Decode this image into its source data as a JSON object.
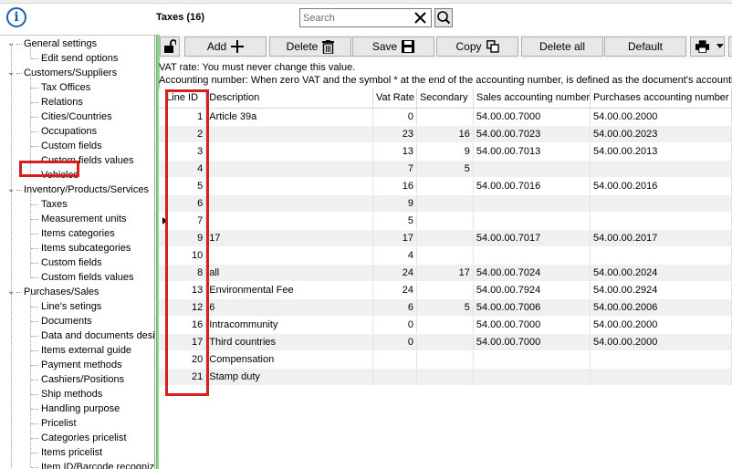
{
  "window": {
    "title": "Taxes (16)"
  },
  "search": {
    "placeholder": "Search",
    "value": ""
  },
  "toolbar": {
    "add_label": "Add",
    "delete_label": "Delete",
    "save_label": "Save",
    "copy_label": "Copy",
    "delete_all_label": "Delete all",
    "default_label": "Default"
  },
  "notes": {
    "vat_rate": "VAT rate: You must never change this value.",
    "accounting": "Accounting number: When zero VAT and the symbol * at the end of the accounting number, is defined as the document's accountin"
  },
  "sidebar": {
    "selected": "Taxes",
    "groups": [
      {
        "label": "General settings",
        "items": [
          "Edit send options"
        ]
      },
      {
        "label": "Customers/Suppliers",
        "items": [
          "Tax Offices",
          "Relations",
          "Cities/Countries",
          "Occupations",
          "Custom fields",
          "Custom fields values",
          "Vehicles"
        ]
      },
      {
        "label": "Inventory/Products/Services",
        "items": [
          "Taxes",
          "Measurement units",
          "Items categories",
          "Items subcategories",
          "Custom fields",
          "Custom fields values"
        ]
      },
      {
        "label": "Purchases/Sales",
        "items": [
          "Line's setings",
          "Documents",
          "Data and documents desi",
          "Items external guide",
          "Payment methods",
          "Cashiers/Positions",
          "Ship methods",
          "Handling purpose",
          "Pricelist",
          "Categories pricelist",
          "Items pricelist",
          "Item ID/Barcode recogniz"
        ]
      }
    ]
  },
  "table": {
    "columns": [
      "Line ID",
      "Description",
      "Vat Rate",
      "Secondary",
      "Sales accounting number",
      "Purchases accounting number"
    ],
    "rows": [
      [
        "1",
        "Article 39a",
        "0",
        "",
        "54.00.00.7000",
        "54.00.00.2000"
      ],
      [
        "2",
        "",
        "23",
        "16",
        "54.00.00.7023",
        "54.00.00.2023"
      ],
      [
        "3",
        "",
        "13",
        "9",
        "54.00.00.7013",
        "54.00.00.2013"
      ],
      [
        "4",
        "",
        "7",
        "5",
        "",
        ""
      ],
      [
        "5",
        "",
        "16",
        "",
        "54.00.00.7016",
        "54.00.00.2016"
      ],
      [
        "6",
        "",
        "9",
        "",
        "",
        ""
      ],
      [
        "7",
        "",
        "5",
        "",
        "",
        ""
      ],
      [
        "9",
        "17",
        "17",
        "",
        "54.00.00.7017",
        "54.00.00.2017"
      ],
      [
        "10",
        "",
        "4",
        "",
        "",
        ""
      ],
      [
        "8",
        "all",
        "24",
        "17",
        "54.00.00.7024",
        "54.00.00.2024"
      ],
      [
        "13",
        "Environmental Fee",
        "24",
        "",
        "54.00.00.7924",
        "54.00.00.2924"
      ],
      [
        "12",
        "6",
        "6",
        "5",
        "54.00.00.7006",
        "54.00.00.2006"
      ],
      [
        "16",
        "Intracommunity",
        "0",
        "",
        "54.00.00.7000",
        "54.00.00.2000"
      ],
      [
        "17",
        "Third countries",
        "0",
        "",
        "54.00.00.7000",
        "54.00.00.2000"
      ],
      [
        "20",
        "Compensation",
        "",
        "",
        "",
        ""
      ],
      [
        "21",
        "Stamp duty",
        "",
        "",
        "",
        ""
      ]
    ]
  },
  "colors": {
    "highlight": "#d42020",
    "splitter": "#8fd18f",
    "info": "#1a5fb4",
    "row_alt": "#f0f0f0"
  }
}
